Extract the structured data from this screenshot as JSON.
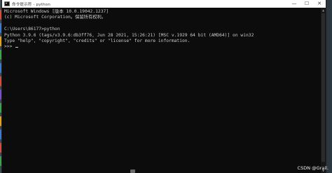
{
  "window": {
    "title": "命令提示符 - python",
    "minimize_glyph": "—",
    "maximize_glyph": "☐",
    "close_glyph": "✕"
  },
  "console": {
    "lines": [
      "Microsoft Windows [版本 10.0.19042.1237]",
      "(c) Microsoft Corporation。保留所有权利。",
      "",
      "C:\\Users\\86177>python",
      "Python 3.9.6 (tags/v3.9.6:db3ff76, Jun 28 2021, 15:26:21) [MSC v.1929 64 bit (AMD64)] on win32",
      "Type \"help\", \"copyright\", \"credits\" or \"license\" for more information.",
      ">>> "
    ],
    "text_color": "#cccccc",
    "background": "#0c0c0c"
  },
  "desktop_icon_colors": [
    "#d94b3a",
    "#3a7bd5",
    "#e3a21a",
    "#3aa54b",
    "#3a7bd5",
    "#d94b3a",
    "#7a4fd1",
    "#3aa54b",
    "#e3a21a",
    "#3a7bd5",
    "#d94b3a",
    "#3aa54b"
  ],
  "watermark": {
    "text": "CSDN @Grail."
  }
}
